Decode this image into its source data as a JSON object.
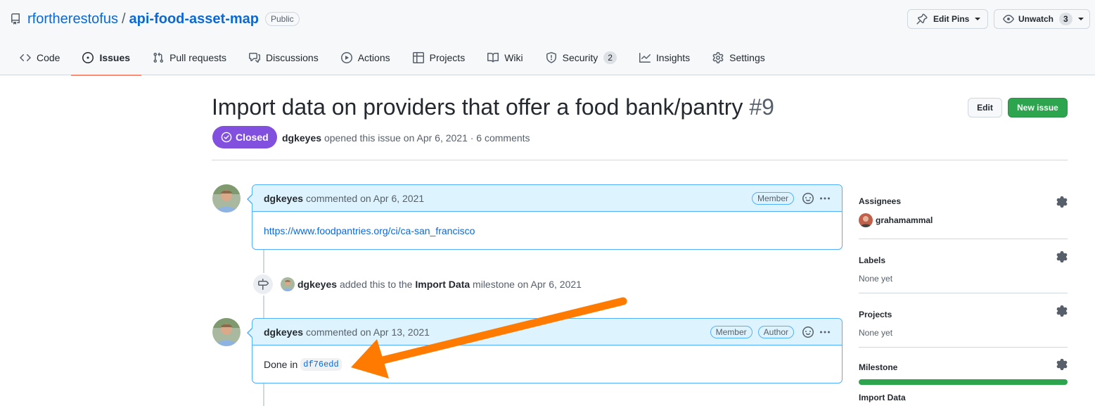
{
  "repo": {
    "owner": "rfortherestofus",
    "separator": "/",
    "name": "api-food-asset-map",
    "visibility": "Public"
  },
  "header_buttons": {
    "edit_pins": "Edit Pins",
    "unwatch": "Unwatch",
    "watch_count": "3"
  },
  "tabs": [
    {
      "label": "Code",
      "icon": "code-icon"
    },
    {
      "label": "Issues",
      "icon": "issue-opened-icon",
      "selected": true
    },
    {
      "label": "Pull requests",
      "icon": "git-pull-request-icon"
    },
    {
      "label": "Discussions",
      "icon": "comment-discussion-icon"
    },
    {
      "label": "Actions",
      "icon": "play-icon"
    },
    {
      "label": "Projects",
      "icon": "table-icon"
    },
    {
      "label": "Wiki",
      "icon": "book-icon"
    },
    {
      "label": "Security",
      "icon": "shield-icon",
      "count": "2"
    },
    {
      "label": "Insights",
      "icon": "graph-icon"
    },
    {
      "label": "Settings",
      "icon": "gear-icon"
    }
  ],
  "issue": {
    "title": "Import data on providers that offer a food bank/pantry",
    "number": "#9",
    "state": "Closed",
    "author": "dgkeyes",
    "meta_text": "opened this issue on Apr 6, 2021 · 6 comments",
    "edit_label": "Edit",
    "new_issue_label": "New issue"
  },
  "timeline": {
    "comment1": {
      "author": "dgkeyes",
      "action": "commented on Apr 6, 2021",
      "role": "Member",
      "body_link": "https://www.foodpantries.org/ci/ca-san_francisco"
    },
    "event": {
      "actor": "dgkeyes",
      "text_before": "added this to the",
      "milestone": "Import Data",
      "text_after": "milestone on Apr 6, 2021"
    },
    "comment2": {
      "author": "dgkeyes",
      "action": "commented on Apr 13, 2021",
      "role_member": "Member",
      "role_author": "Author",
      "body_text": "Done in",
      "commit": "df76edd"
    }
  },
  "sidebar": {
    "assignees_heading": "Assignees",
    "assignee": "grahamammal",
    "labels_heading": "Labels",
    "labels_value": "None yet",
    "projects_heading": "Projects",
    "projects_value": "None yet",
    "milestone_heading": "Milestone",
    "milestone_progress": 1.0,
    "milestone_name": "Import Data"
  },
  "colors": {
    "accent_link": "#0969da",
    "closed_purple": "#8250df",
    "new_issue_green": "#2da44e",
    "annotation_arrow": "#ff7a00"
  }
}
